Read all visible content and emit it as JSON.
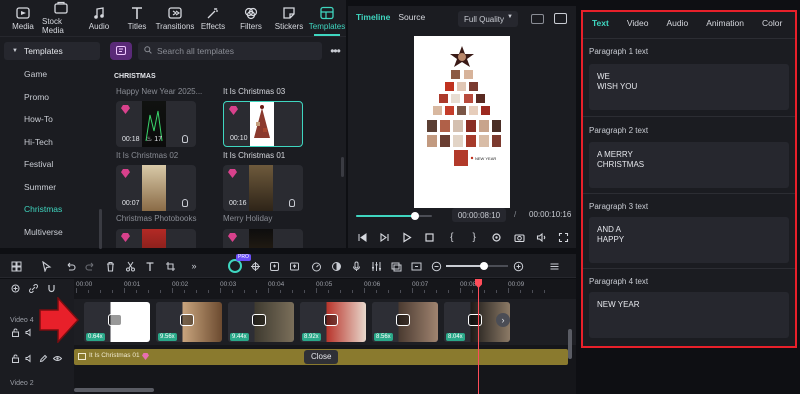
{
  "toolbar": {
    "items": [
      {
        "label": "Media",
        "icon": "media-icon"
      },
      {
        "label": "Stock Media",
        "icon": "stock-media-icon"
      },
      {
        "label": "Audio",
        "icon": "audio-icon"
      },
      {
        "label": "Titles",
        "icon": "titles-icon"
      },
      {
        "label": "Transitions",
        "icon": "transitions-icon"
      },
      {
        "label": "Effects",
        "icon": "effects-icon"
      },
      {
        "label": "Filters",
        "icon": "filters-icon"
      },
      {
        "label": "Stickers",
        "icon": "stickers-icon"
      },
      {
        "label": "Templates",
        "icon": "templates-icon",
        "active": true
      }
    ]
  },
  "sidebar": {
    "header": "Templates",
    "items": [
      "Game",
      "Promo",
      "How-To",
      "Hi-Tech",
      "Festival",
      "Summer",
      "Christmas",
      "Multiverse"
    ],
    "active": "Christmas"
  },
  "templates": {
    "search_placeholder": "Search all templates",
    "section": "CHRISTMAS",
    "cards": [
      {
        "caption": "Happy New Year 2025...",
        "duration": "00:18",
        "likes": "17",
        "selected": false
      },
      {
        "caption": "It Is Christmas 03",
        "duration": "00:10",
        "likes": "",
        "selected": true
      },
      {
        "caption": "It Is Christmas 02",
        "duration": "00:07",
        "likes": "",
        "selected": false
      },
      {
        "caption": "It Is Christmas 01",
        "duration": "00:16",
        "likes": "",
        "selected": false
      },
      {
        "caption": "Christmas Photobooks",
        "duration": "",
        "likes": "",
        "selected": false
      },
      {
        "caption": "Merry Holiday",
        "duration": "",
        "likes": "",
        "selected": false
      }
    ]
  },
  "player": {
    "tabs": {
      "timeline": "Timeline",
      "source": "Source"
    },
    "quality": "Full Quality",
    "current_time": "00:00:08:10",
    "separator": "/",
    "total_time": "00:00:10:16",
    "progress": 0.78,
    "preview_caption": "NEW YEAR"
  },
  "properties": {
    "tabs": [
      "Text",
      "Video",
      "Audio",
      "Animation",
      "Color"
    ],
    "active_tab": "Text",
    "paragraphs": [
      {
        "label": "Paragraph 1 text",
        "text": "WE\nWISH YOU"
      },
      {
        "label": "Paragraph 2 text",
        "text": "A MERRY\nCHRISTMAS"
      },
      {
        "label": "Paragraph 3 text",
        "text": "AND A\nHAPPY"
      },
      {
        "label": "Paragraph 4 text",
        "text": "NEW YEAR"
      }
    ],
    "highlight_color": "#e8202a"
  },
  "timeline": {
    "ruler": [
      "00:00",
      "00:01",
      "00:02",
      "00:03",
      "00:04",
      "00:05",
      "00:06",
      "00:07",
      "00:08",
      "00:09"
    ],
    "tracks": {
      "video4": "Video 4",
      "video2": "Video 2"
    },
    "clips": [
      {
        "speed": "0.64x"
      },
      {
        "speed": "9.56x"
      },
      {
        "speed": "9.44x"
      },
      {
        "speed": "8.92x"
      },
      {
        "speed": "8.56x"
      },
      {
        "speed": "8.04x"
      }
    ],
    "template_track": "It Is Christmas 01",
    "tooltip": "Close",
    "ai_badge": "PRO",
    "zoom_level": 0.62
  },
  "colors": {
    "accent": "#3fd6c0",
    "playhead": "#ff4d5a",
    "template_track": "#8a7a2e"
  }
}
